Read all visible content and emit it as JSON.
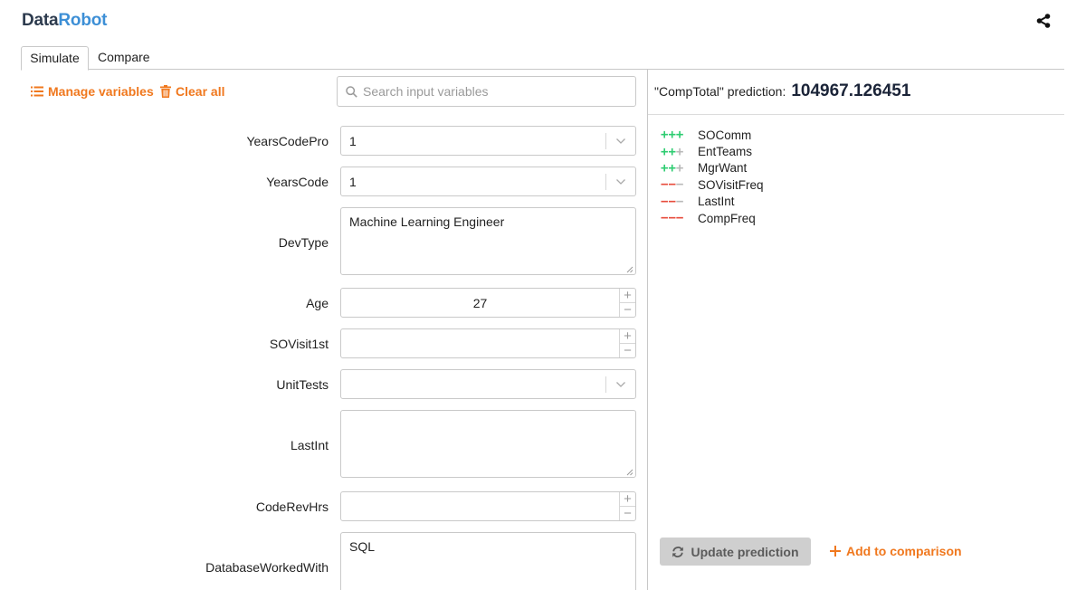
{
  "app": {
    "logo_part1": "Data",
    "logo_part2": "Robot"
  },
  "tabs": [
    {
      "label": "Simulate",
      "active": true
    },
    {
      "label": "Compare",
      "active": false
    }
  ],
  "toolbar": {
    "manage_label": "Manage variables",
    "clear_label": "Clear all",
    "search_placeholder": "Search input variables"
  },
  "prediction": {
    "label": "\"CompTotal\" prediction:",
    "value": "104967.126451"
  },
  "explanations": [
    {
      "signs": [
        "+",
        "+",
        "+"
      ],
      "strength": 3,
      "direction": "positive",
      "feature": "SOComm"
    },
    {
      "signs": [
        "+",
        "+",
        "+"
      ],
      "strength": 2,
      "direction": "positive",
      "feature": "EntTeams"
    },
    {
      "signs": [
        "+",
        "+",
        "+"
      ],
      "strength": 2,
      "direction": "positive",
      "feature": "MgrWant"
    },
    {
      "signs": [
        "−",
        "−",
        "−"
      ],
      "strength": 2,
      "direction": "negative",
      "feature": "SOVisitFreq"
    },
    {
      "signs": [
        "−",
        "−",
        "−"
      ],
      "strength": 2,
      "direction": "negative",
      "feature": "LastInt"
    },
    {
      "signs": [
        "−",
        "−",
        "−"
      ],
      "strength": 3,
      "direction": "negative",
      "feature": "CompFreq"
    }
  ],
  "fields": {
    "years_code_pro": {
      "label": "YearsCodePro",
      "value": "1"
    },
    "years_code": {
      "label": "YearsCode",
      "value": "1"
    },
    "dev_type": {
      "label": "DevType",
      "value": "Machine Learning Engineer"
    },
    "age": {
      "label": "Age",
      "value": "27"
    },
    "so_visit_1st": {
      "label": "SOVisit1st",
      "value": ""
    },
    "unit_tests": {
      "label": "UnitTests",
      "value": ""
    },
    "last_int": {
      "label": "LastInt",
      "value": ""
    },
    "code_rev_hrs": {
      "label": "CodeRevHrs",
      "value": ""
    },
    "database_worked_with": {
      "label": "DatabaseWorkedWith",
      "value": "SQL"
    }
  },
  "actions": {
    "update_label": "Update prediction",
    "add_label": "Add to comparison"
  },
  "colors": {
    "accent": "#f0781e",
    "positive": "#2ecc71",
    "negative": "#e74c3c",
    "logo_dark": "#2d3b4e",
    "logo_blue": "#3d8fd6"
  }
}
